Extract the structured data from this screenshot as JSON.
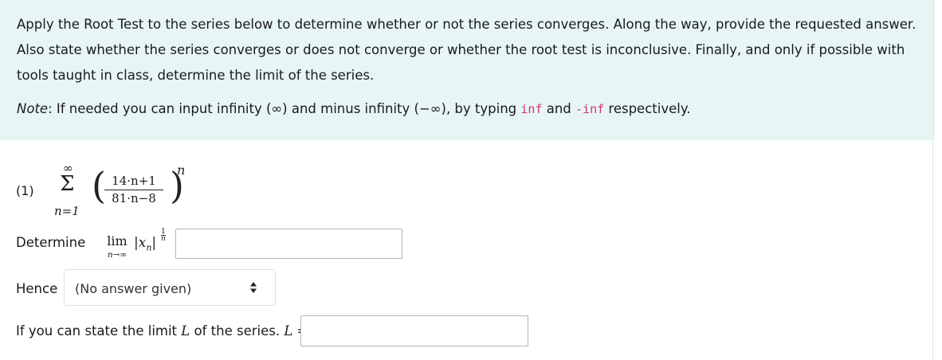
{
  "intro": "Apply the Root Test to the series below to determine whether or not the series converges. Along the way, provide the requested answer. Also state whether the series converges or does not converge or whether the root test is inconclusive. Finally, and only if possible with tools taught in class, determine the limit of the series.",
  "note": {
    "label": "Note",
    "before": ": If needed you can input infinity (∞) and minus infinity (−∞), by typing ",
    "inf": "inf",
    "and": " and ",
    "neginf": "-inf",
    "after": " respectively."
  },
  "series": {
    "label": "(1)",
    "sum_upper": "∞",
    "sum_symbol": "Σ",
    "sum_lower": "n=1",
    "numerator": "14·n+1",
    "denominator": "81·n−8",
    "exponent": "n"
  },
  "determine": {
    "text": "Determine",
    "lim": "lim",
    "lim_under": "n→∞",
    "abs": "|x",
    "abs_sub": "n",
    "abs_close": "|",
    "pow_num": "1",
    "pow_den": "n",
    "equals": "=",
    "value": ""
  },
  "hence": {
    "label": "Hence",
    "selected": "(No answer given)"
  },
  "limit": {
    "text": "If you can state the limit ",
    "L": "L",
    "text2": " of the series. ",
    "L2": "L",
    "equals": " =",
    "value": ""
  }
}
